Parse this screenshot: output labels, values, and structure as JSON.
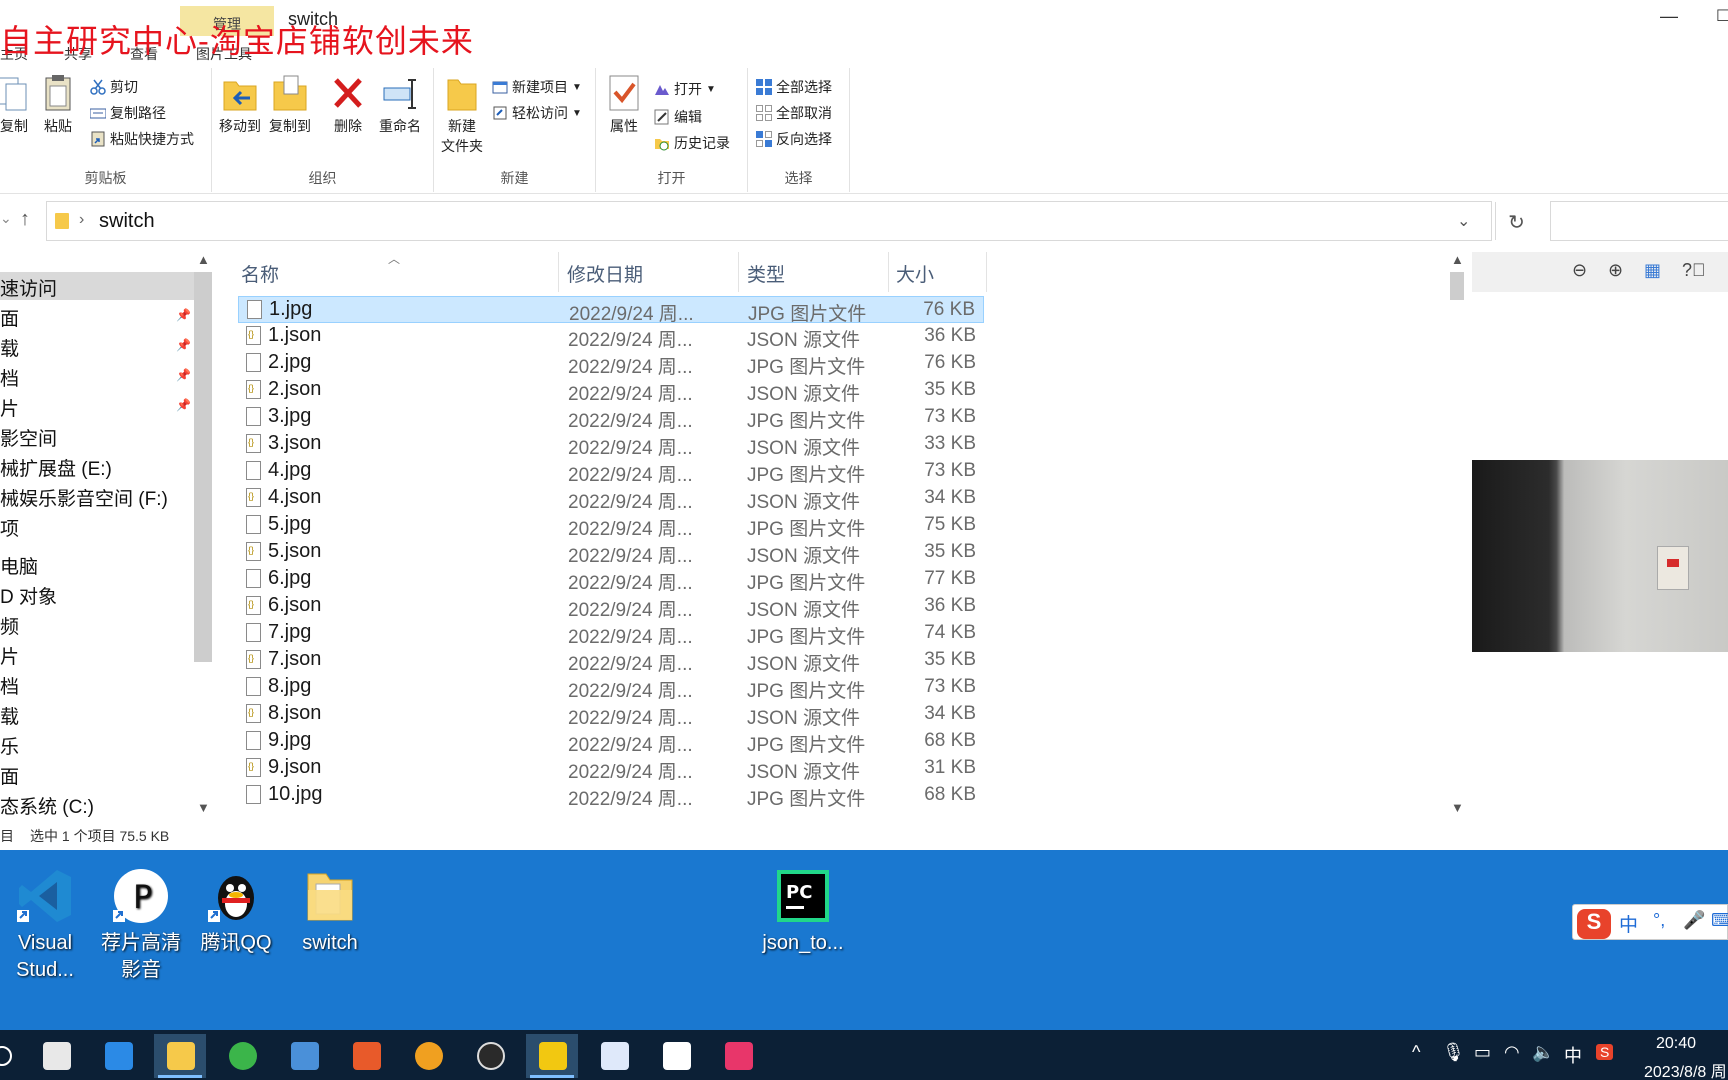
{
  "watermark": "自主研究中心-淘宝店铺软创未来",
  "window": {
    "contextual_tab": "管理",
    "title": "switch",
    "menu_tabs": [
      "主页",
      "共享",
      "查看",
      "图片工具"
    ]
  },
  "ribbon": {
    "clipboard": {
      "label": "剪贴板",
      "copy": "复制",
      "paste": "粘贴",
      "cut": "剪切",
      "copy_path": "复制路径",
      "paste_shortcut": "粘贴快捷方式"
    },
    "organize": {
      "label": "组织",
      "move_to": "移动到",
      "copy_to": "复制到",
      "delete": "删除",
      "rename": "重命名"
    },
    "new": {
      "label": "新建",
      "new_folder_line1": "新建",
      "new_folder_line2": "文件夹",
      "new_item": "新建项目",
      "easy_access": "轻松访问"
    },
    "open": {
      "label": "打开",
      "properties": "属性",
      "open": "打开",
      "edit": "编辑",
      "history": "历史记录"
    },
    "select": {
      "label": "选择",
      "select_all": "全部选择",
      "select_none": "全部取消",
      "invert": "反向选择"
    }
  },
  "address": {
    "path": "switch"
  },
  "nav": {
    "items": [
      "速访问",
      "面",
      "载",
      "档",
      "片",
      "影空间",
      "械扩展盘 (E:)",
      "械娱乐影音空间 (F:)",
      "项",
      "电脑",
      "D 对象",
      "频",
      "片",
      "档",
      "载",
      "乐",
      "面",
      "态系统 (C:)"
    ]
  },
  "columns": {
    "name": "名称",
    "date": "修改日期",
    "type": "类型",
    "size": "大小"
  },
  "files": [
    {
      "name": "1.jpg",
      "date": "2022/9/24 周...",
      "type": "JPG 图片文件",
      "size": "76 KB"
    },
    {
      "name": "1.json",
      "date": "2022/9/24 周...",
      "type": "JSON 源文件",
      "size": "36 KB"
    },
    {
      "name": "2.jpg",
      "date": "2022/9/24 周...",
      "type": "JPG 图片文件",
      "size": "76 KB"
    },
    {
      "name": "2.json",
      "date": "2022/9/24 周...",
      "type": "JSON 源文件",
      "size": "35 KB"
    },
    {
      "name": "3.jpg",
      "date": "2022/9/24 周...",
      "type": "JPG 图片文件",
      "size": "73 KB"
    },
    {
      "name": "3.json",
      "date": "2022/9/24 周...",
      "type": "JSON 源文件",
      "size": "33 KB"
    },
    {
      "name": "4.jpg",
      "date": "2022/9/24 周...",
      "type": "JPG 图片文件",
      "size": "73 KB"
    },
    {
      "name": "4.json",
      "date": "2022/9/24 周...",
      "type": "JSON 源文件",
      "size": "34 KB"
    },
    {
      "name": "5.jpg",
      "date": "2022/9/24 周...",
      "type": "JPG 图片文件",
      "size": "75 KB"
    },
    {
      "name": "5.json",
      "date": "2022/9/24 周...",
      "type": "JSON 源文件",
      "size": "35 KB"
    },
    {
      "name": "6.jpg",
      "date": "2022/9/24 周...",
      "type": "JPG 图片文件",
      "size": "77 KB"
    },
    {
      "name": "6.json",
      "date": "2022/9/24 周...",
      "type": "JSON 源文件",
      "size": "36 KB"
    },
    {
      "name": "7.jpg",
      "date": "2022/9/24 周...",
      "type": "JPG 图片文件",
      "size": "74 KB"
    },
    {
      "name": "7.json",
      "date": "2022/9/24 周...",
      "type": "JSON 源文件",
      "size": "35 KB"
    },
    {
      "name": "8.jpg",
      "date": "2022/9/24 周...",
      "type": "JPG 图片文件",
      "size": "73 KB"
    },
    {
      "name": "8.json",
      "date": "2022/9/24 周...",
      "type": "JSON 源文件",
      "size": "34 KB"
    },
    {
      "name": "9.jpg",
      "date": "2022/9/24 周...",
      "type": "JPG 图片文件",
      "size": "68 KB"
    },
    {
      "name": "9.json",
      "date": "2022/9/24 周...",
      "type": "JSON 源文件",
      "size": "31 KB"
    },
    {
      "name": "10.jpg",
      "date": "2022/9/24 周...",
      "type": "JPG 图片文件",
      "size": "68 KB"
    }
  ],
  "status": {
    "count_suffix": "目",
    "selection": "选中 1 个项目  75.5 KB"
  },
  "desktop": {
    "vscode_line1": "Visual",
    "vscode_line2": "Stud...",
    "player_line1": "荐片高清",
    "player_line2": "影音",
    "qq": "腾讯QQ",
    "switch": "switch",
    "pycharm": "json_to..."
  },
  "ime": {
    "mode": "中",
    "punctuation": "°,",
    "logo": "S"
  },
  "taskbar": {
    "lang": "中",
    "time": "20:40",
    "date": "2023/8/8 周"
  },
  "colors": {
    "accent": "#0078d7",
    "selection": "#cce8ff",
    "watermark": "#e6141e",
    "desktop": "#1a78d0",
    "taskbar": "#0c2036"
  }
}
